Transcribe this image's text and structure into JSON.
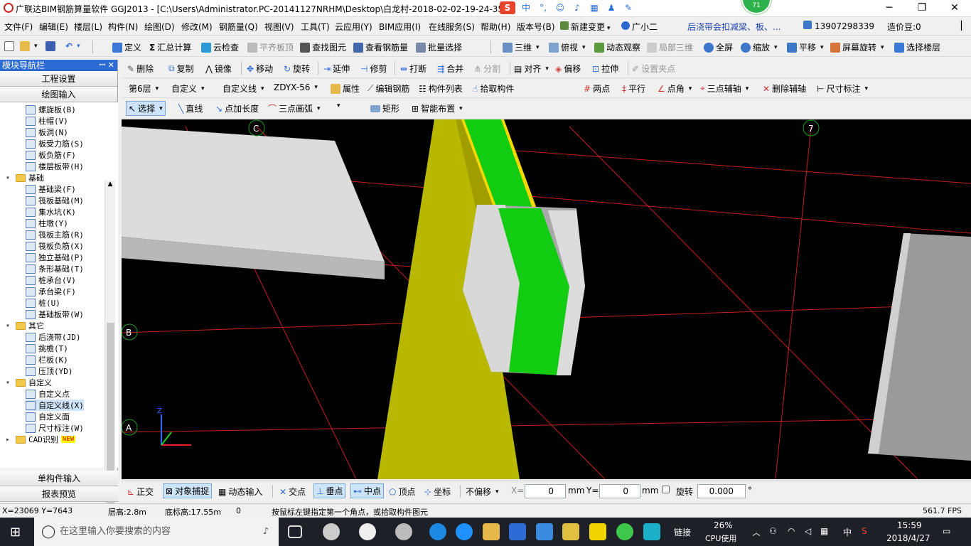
{
  "titlebar": {
    "title": "广联达BIM钢筋算量软件 GGJ2013 - [C:\\Users\\Administrator.PC-20141127NRHM\\Desktop\\白龙村-2018-02-02-19-24-35",
    "ime_zh": "中",
    "ime_punct": "°,",
    "badge": "71"
  },
  "menu": [
    "文件(F)",
    "编辑(E)",
    "楼层(L)",
    "构件(N)",
    "绘图(D)",
    "修改(M)",
    "钢筋量(Q)",
    "视图(V)",
    "工具(T)",
    "云应用(Y)",
    "BIM应用(I)",
    "在线服务(S)",
    "帮助(H)",
    "版本号(B)",
    "新建变更",
    "广小二",
    "后浇带会扣减梁、板、...",
    "13907298339",
    "造价豆:0"
  ],
  "toolbar1": [
    "定义",
    "汇总计算",
    "云检查",
    "平齐板顶",
    "查找图元",
    "查看钢筋量",
    "批量选择",
    "三维",
    "俯视",
    "动态观察",
    "局部三维",
    "全屏",
    "缩放",
    "平移",
    "屏幕旋转",
    "选择楼层"
  ],
  "toolbar2": [
    "删除",
    "复制",
    "镜像",
    "移动",
    "旋转",
    "延伸",
    "修剪",
    "打断",
    "合并",
    "分割",
    "对齐",
    "偏移",
    "拉伸",
    "设置夹点"
  ],
  "toolbar3": {
    "floor": "第6层",
    "type": "自定义",
    "subtype": "自定义线",
    "code": "ZDYX-56",
    "items": [
      "属性",
      "编辑钢筋",
      "构件列表",
      "拾取构件"
    ],
    "right": [
      "两点",
      "平行",
      "点角",
      "三点辅轴",
      "删除辅轴",
      "尺寸标注"
    ]
  },
  "toolbar4": [
    "选择",
    "直线",
    "点加长度",
    "三点画弧",
    "矩形",
    "智能布置"
  ],
  "nav": {
    "title": "模块导航栏",
    "btn_project": "工程设置",
    "btn_draw": "绘图输入",
    "btn_single": "单构件输入",
    "btn_report": "报表预览",
    "tree": [
      {
        "label": "螺旋板(B)",
        "level": 2
      },
      {
        "label": "柱帽(V)",
        "level": 2
      },
      {
        "label": "板洞(N)",
        "level": 2
      },
      {
        "label": "板受力筋(S)",
        "level": 2
      },
      {
        "label": "板负筋(F)",
        "level": 2
      },
      {
        "label": "楼层板带(H)",
        "level": 2
      },
      {
        "label": "基础",
        "level": 1
      },
      {
        "label": "基础梁(F)",
        "level": 2
      },
      {
        "label": "筏板基础(M)",
        "level": 2
      },
      {
        "label": "集水坑(K)",
        "level": 2
      },
      {
        "label": "柱墩(Y)",
        "level": 2
      },
      {
        "label": "筏板主筋(R)",
        "level": 2
      },
      {
        "label": "筏板负筋(X)",
        "level": 2
      },
      {
        "label": "独立基础(P)",
        "level": 2
      },
      {
        "label": "条形基础(T)",
        "level": 2
      },
      {
        "label": "桩承台(V)",
        "level": 2
      },
      {
        "label": "承台梁(F)",
        "level": 2
      },
      {
        "label": "桩(U)",
        "level": 2
      },
      {
        "label": "基础板带(W)",
        "level": 2
      },
      {
        "label": "其它",
        "level": 1
      },
      {
        "label": "后浇带(JD)",
        "level": 2
      },
      {
        "label": "挑檐(T)",
        "level": 2
      },
      {
        "label": "栏板(K)",
        "level": 2
      },
      {
        "label": "压顶(YD)",
        "level": 2
      },
      {
        "label": "自定义",
        "level": 1
      },
      {
        "label": "自定义点",
        "level": 2
      },
      {
        "label": "自定义线(X)",
        "level": 2
      },
      {
        "label": "自定义面",
        "level": 2
      },
      {
        "label": "尺寸标注(W)",
        "level": 2
      },
      {
        "label": "CAD识别",
        "level": 1
      }
    ],
    "new_badge": "NEW"
  },
  "viewport": {
    "axis_labels": [
      "C",
      "7",
      "B",
      "A",
      "Z"
    ]
  },
  "bottombar": {
    "items": [
      "正交",
      "对象捕捉",
      "动态输入",
      "交点",
      "垂点",
      "中点",
      "顶点",
      "坐标"
    ],
    "offset": "不偏移",
    "x_label": "X=",
    "x_value": "0",
    "y_label": "Y=",
    "y_value": "0",
    "unit": "mm",
    "rotate_label": "旋转",
    "rotate_value": "0.000",
    "degree": "°"
  },
  "status": {
    "coords": "X=23069 Y=7643",
    "floor_height": "层高:2.8m",
    "base_height": "底标高:17.55m",
    "zero": "0",
    "hint": "按鼠标左键指定第一个角点，或拾取构件图元",
    "fps": "561.7 FPS"
  },
  "taskbar": {
    "search_placeholder": "在这里输入你要搜索的内容",
    "link": "链接",
    "cpu_pct": "26%",
    "cpu_label": "CPU使用",
    "lang": "中",
    "time": "15:59",
    "date": "2018/4/27"
  }
}
